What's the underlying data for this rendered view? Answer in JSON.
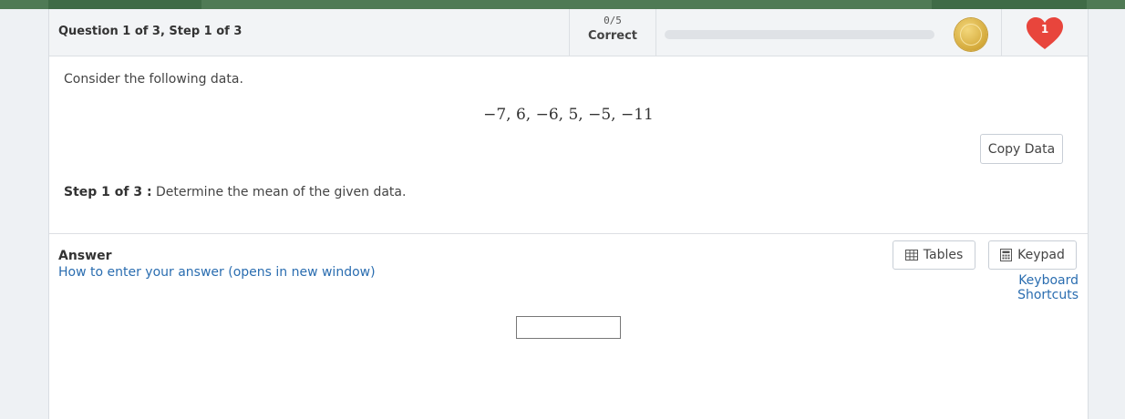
{
  "header": {
    "question_title": "Question 1 of 3, Step 1 of 3",
    "score_value": "0/5",
    "score_label": "Correct",
    "progress_fraction": 0,
    "hearts_count": "1"
  },
  "question": {
    "prompt": "Consider the following data.",
    "data_values": "−7, 6, −6, 5, −5, −11",
    "copy_button_label": "Copy Data",
    "step_label": "Step 1 of 3 :",
    "step_text": "Determine the mean of the given data."
  },
  "answer": {
    "label": "Answer",
    "help_link": "How to enter your answer (opens in new window)",
    "tables_button": "Tables",
    "keypad_button": "Keypad",
    "keyboard_shortcuts_link": "Keyboard Shortcuts",
    "input_value": ""
  },
  "colors": {
    "top_bar": "#4f7a55",
    "link": "#2a6db0",
    "heart": "#e8453c",
    "coin": "#d4a93a"
  }
}
